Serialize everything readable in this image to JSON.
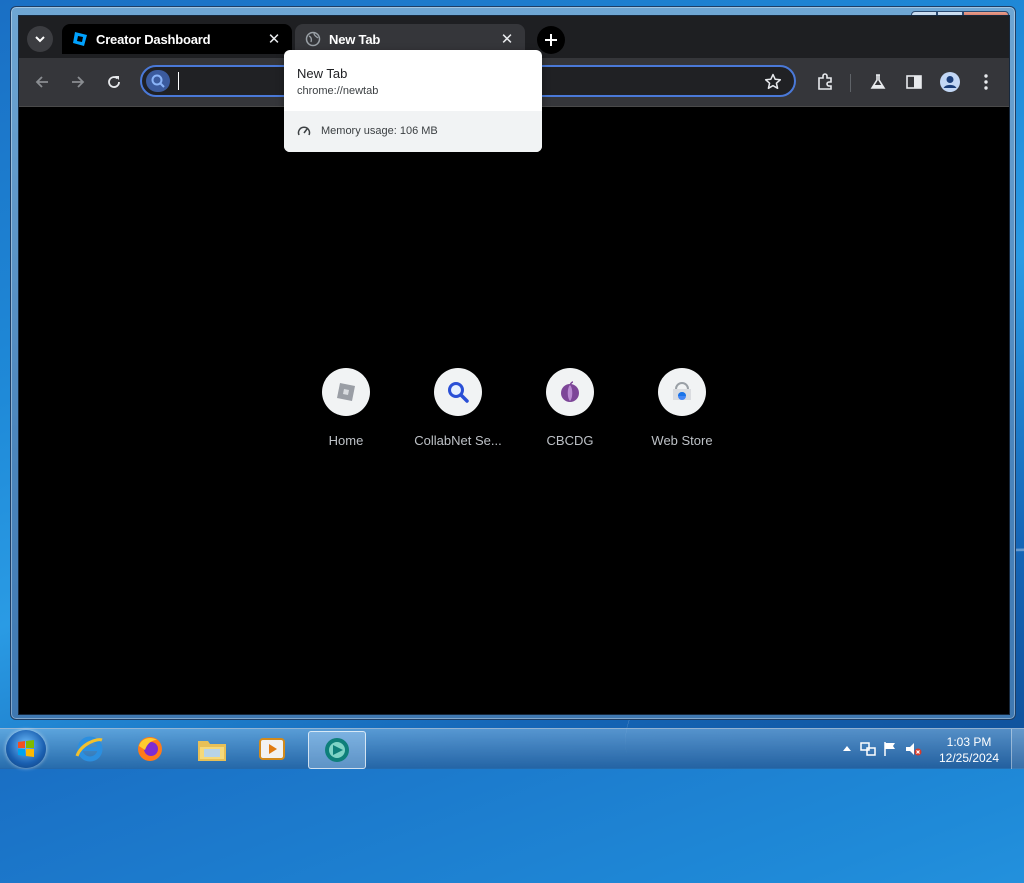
{
  "browser": {
    "tabs": [
      {
        "title": "Creator Dashboard",
        "active": false
      },
      {
        "title": "New Tab",
        "active": true
      }
    ],
    "omnibox": {
      "value": "",
      "placeholder": ""
    },
    "hover_card": {
      "title": "New Tab",
      "url": "chrome://newtab",
      "memory": "Memory usage: 106 MB"
    },
    "shortcuts": [
      {
        "label": "Home",
        "icon": "roblox-icon"
      },
      {
        "label": "CollabNet Se...",
        "icon": "magnifier-icon"
      },
      {
        "label": "CBCDG",
        "icon": "tor-onion-icon"
      },
      {
        "label": "Web Store",
        "icon": "webstore-icon"
      }
    ]
  },
  "taskbar": {
    "items": [
      "internet-explorer-icon",
      "firefox-icon",
      "file-explorer-icon",
      "media-player-icon",
      "browser-app-icon"
    ],
    "time": "1:03 PM",
    "date": "12/25/2024"
  },
  "colors": {
    "accent": "#4a79d8",
    "page_bg": "#000000",
    "toolbar_bg": "#35363a"
  }
}
